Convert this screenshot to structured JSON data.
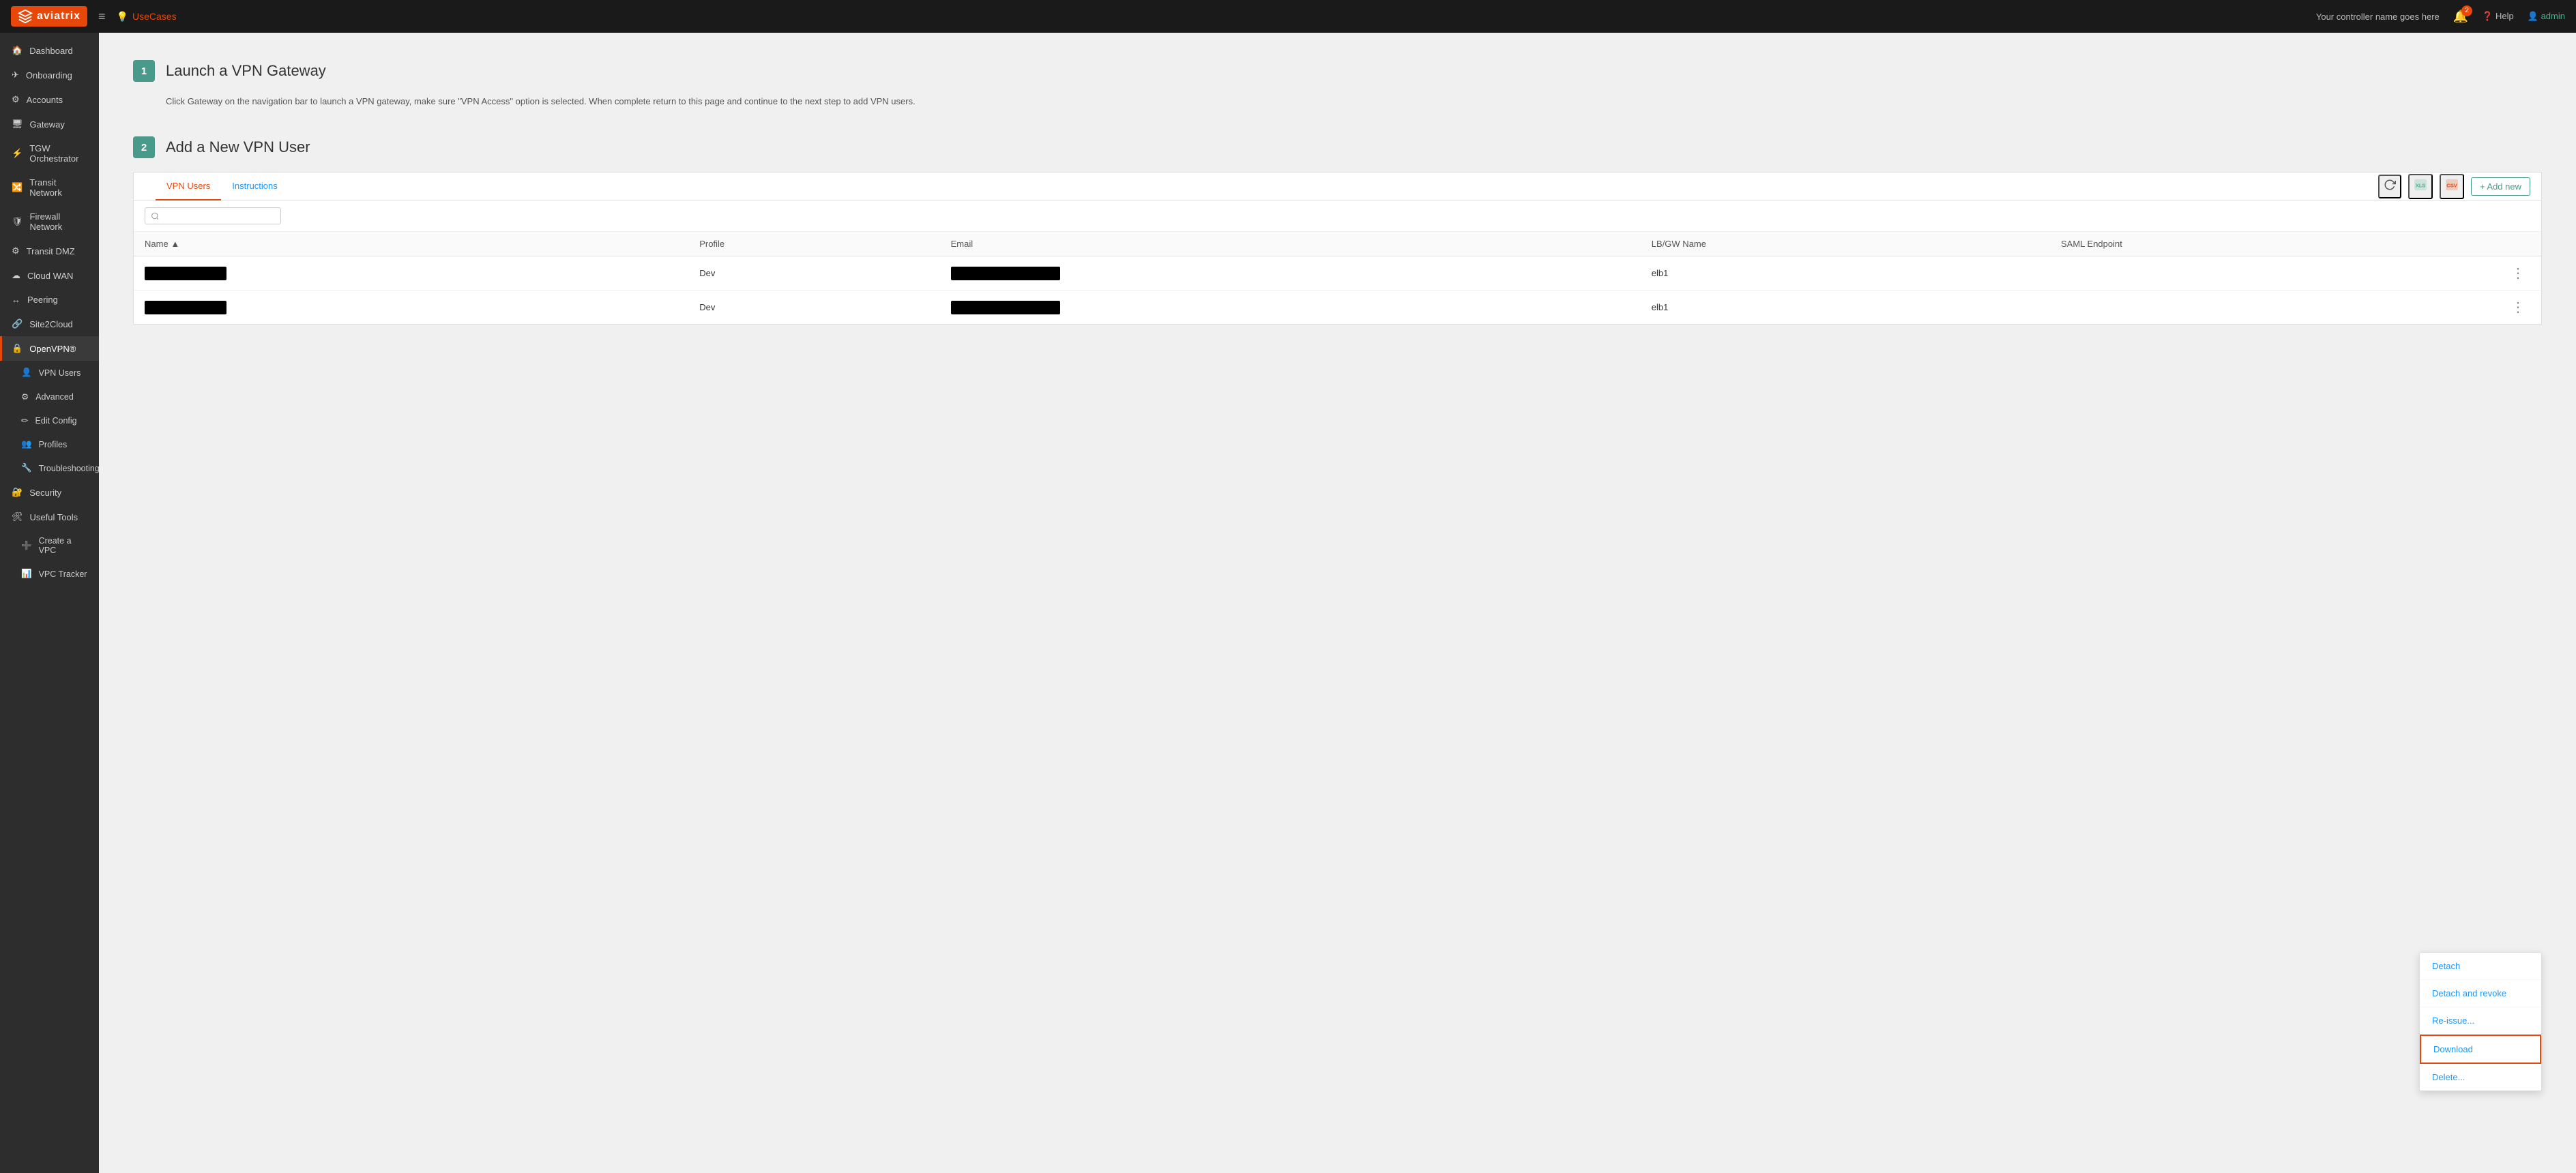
{
  "navbar": {
    "logo_text": "aviatrix",
    "menu_icon": "≡",
    "use_cases_icon": "💡",
    "use_cases_label": "UseCases",
    "controller_name": "Your controller name goes here",
    "bell_count": "2",
    "help_label": "Help",
    "admin_label": "admin"
  },
  "sidebar": {
    "items": [
      {
        "id": "dashboard",
        "label": "Dashboard",
        "icon": "home"
      },
      {
        "id": "onboarding",
        "label": "Onboarding",
        "icon": "onboard"
      },
      {
        "id": "accounts",
        "label": "Accounts",
        "icon": "accounts"
      },
      {
        "id": "gateway",
        "label": "Gateway",
        "icon": "gateway"
      },
      {
        "id": "tgw",
        "label": "TGW Orchestrator",
        "icon": "tgw"
      },
      {
        "id": "transit-network",
        "label": "Transit Network",
        "icon": "transit"
      },
      {
        "id": "firewall-network",
        "label": "Firewall Network",
        "icon": "firewall"
      },
      {
        "id": "transit-dmz",
        "label": "Transit DMZ",
        "icon": "dmz"
      },
      {
        "id": "cloud-wan",
        "label": "Cloud WAN",
        "icon": "cloud"
      },
      {
        "id": "peering",
        "label": "Peering",
        "icon": "peering"
      },
      {
        "id": "site2cloud",
        "label": "Site2Cloud",
        "icon": "site2cloud"
      },
      {
        "id": "openvpn",
        "label": "OpenVPN®",
        "icon": "vpn"
      },
      {
        "id": "vpn-users",
        "label": "VPN Users",
        "icon": "user",
        "sub": true
      },
      {
        "id": "advanced",
        "label": "Advanced",
        "icon": "advanced",
        "sub": true
      },
      {
        "id": "edit-config",
        "label": "Edit Config",
        "icon": "edit",
        "sub": true
      },
      {
        "id": "profiles",
        "label": "Profiles",
        "icon": "profiles",
        "sub": true
      },
      {
        "id": "troubleshooting",
        "label": "Troubleshooting",
        "icon": "trouble",
        "sub": true
      },
      {
        "id": "security",
        "label": "Security",
        "icon": "security"
      },
      {
        "id": "useful-tools",
        "label": "Useful Tools",
        "icon": "tools"
      },
      {
        "id": "create-vpc",
        "label": "Create a VPC",
        "icon": "vpc",
        "sub": true
      },
      {
        "id": "vpc-tracker",
        "label": "VPC Tracker",
        "icon": "tracker",
        "sub": true
      }
    ]
  },
  "main": {
    "step1": {
      "number": "1",
      "title": "Launch a VPN Gateway",
      "description": "Click Gateway on the navigation bar to launch a VPN gateway, make sure \"VPN Access\" option is selected. When complete return to this page and continue to the next step to add VPN users."
    },
    "step2": {
      "number": "2",
      "title": "Add a New VPN User"
    },
    "table": {
      "tab_vpn_users": "VPN Users",
      "tab_instructions": "Instructions",
      "search_placeholder": "",
      "add_new_label": "+ Add new",
      "columns": [
        "Name",
        "Profile",
        "Email",
        "LB/GW Name",
        "SAML Endpoint"
      ],
      "rows": [
        {
          "name": "REDACTED",
          "profile": "Dev",
          "email": "REDACTED",
          "lb_gw": "elb1",
          "saml": ""
        },
        {
          "name": "REDACTED",
          "profile": "Dev",
          "email": "REDACTED",
          "lb_gw": "elb1",
          "saml": ""
        }
      ]
    },
    "context_menu": {
      "items": [
        "Detach",
        "Detach and revoke",
        "Re-issue...",
        "Download",
        "Delete..."
      ]
    }
  }
}
